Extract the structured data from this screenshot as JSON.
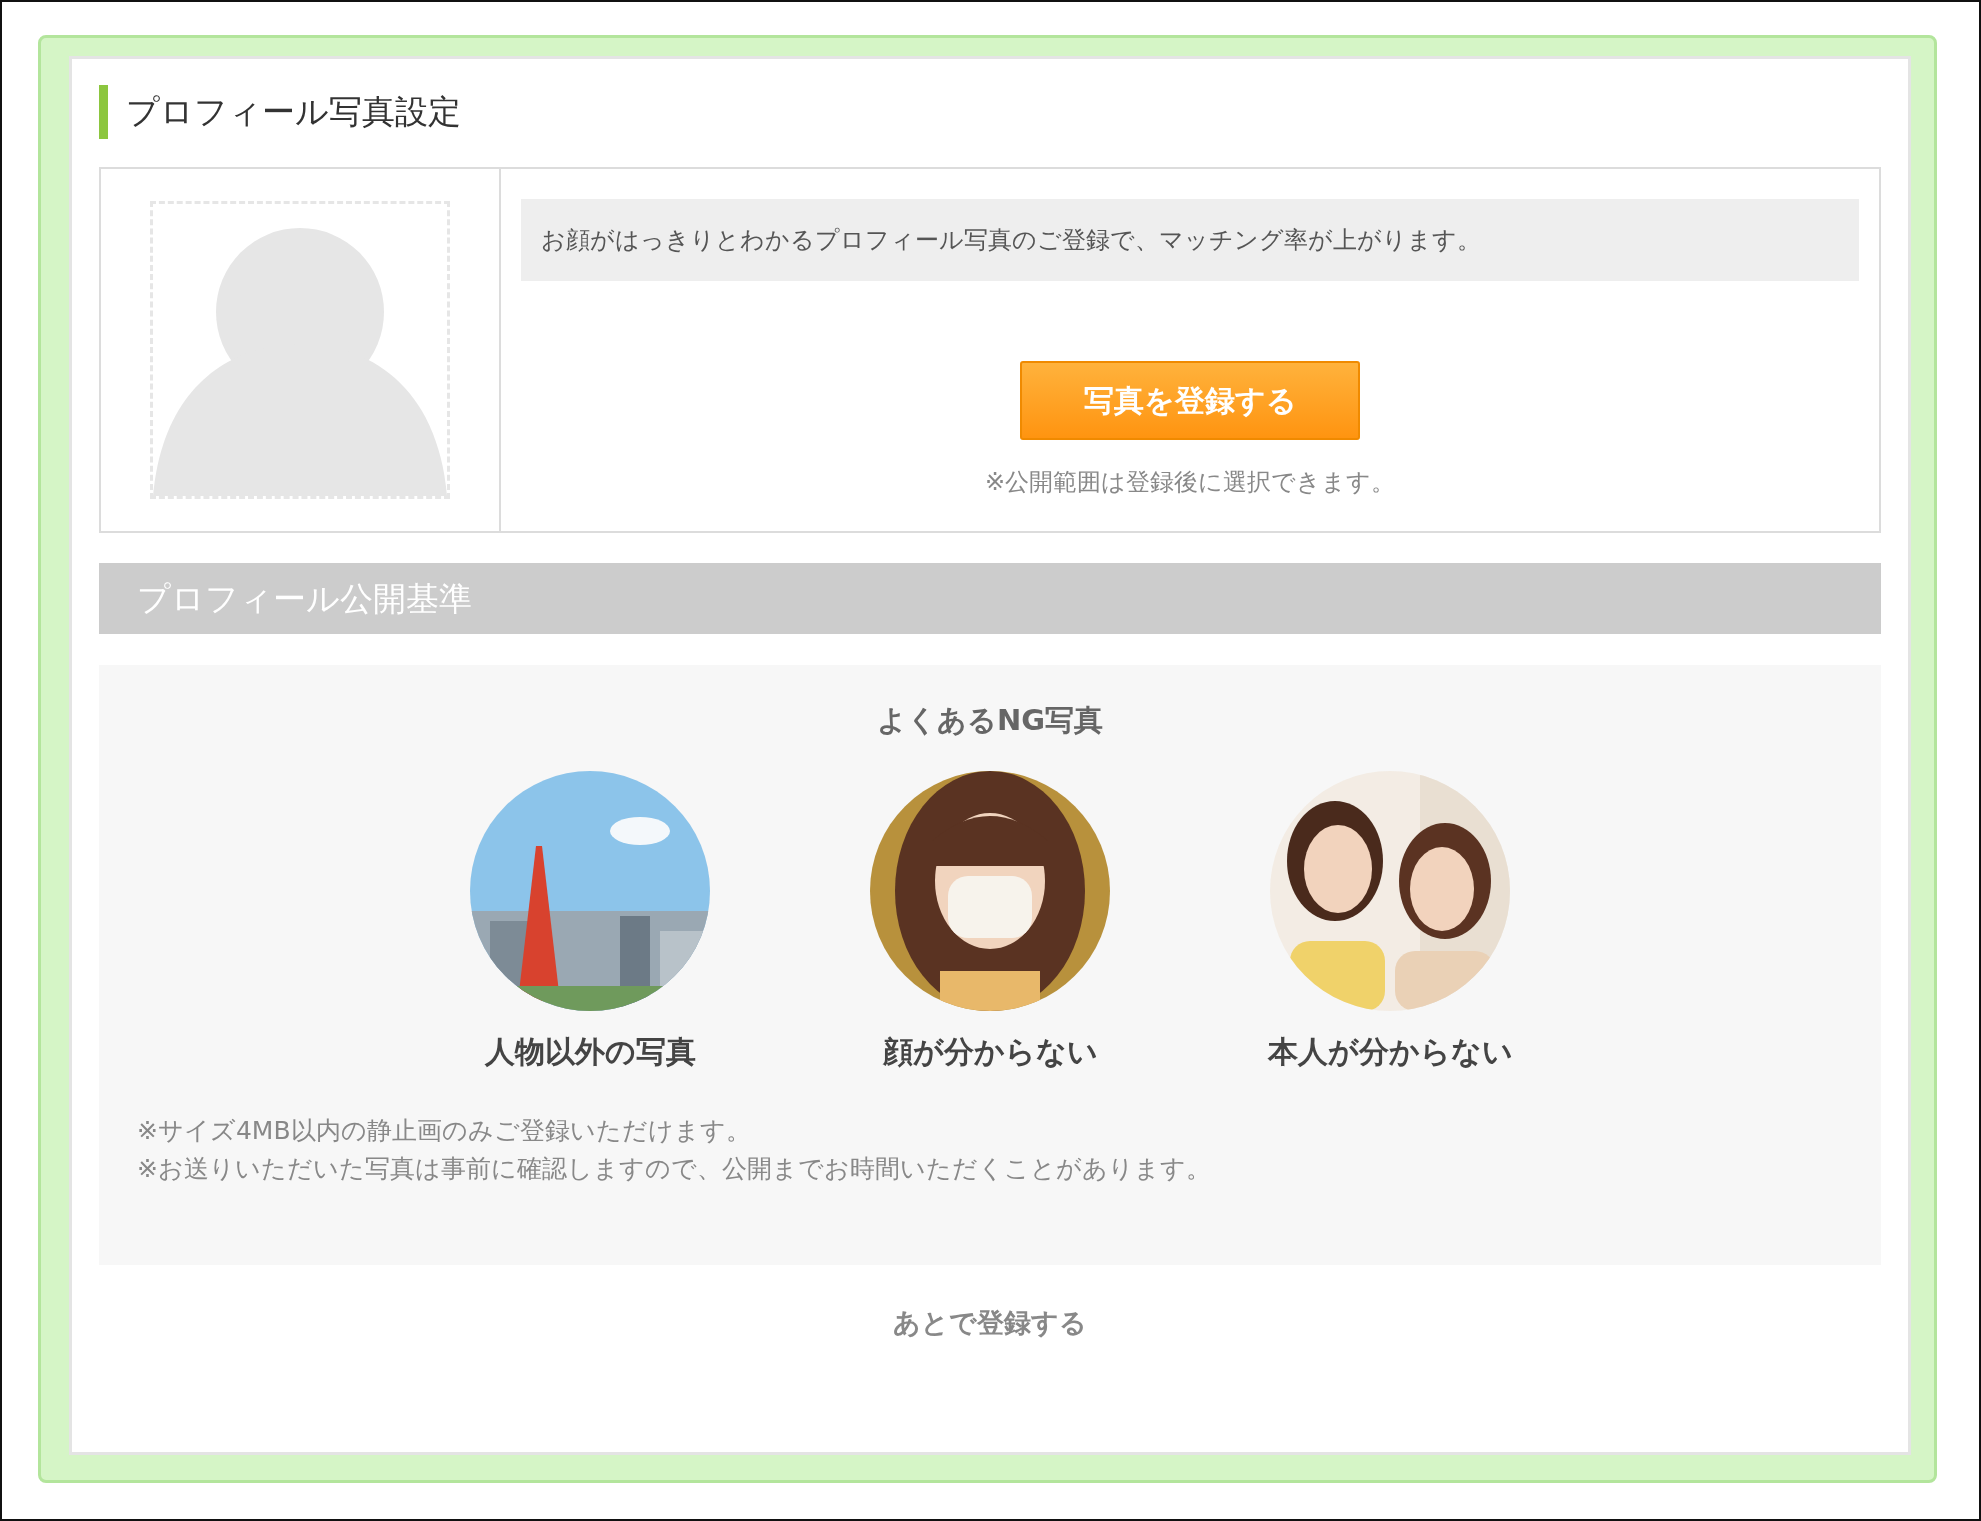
{
  "title": "プロフィール写真設定",
  "photo_section": {
    "hint": "お顔がはっきりとわかるプロフィール写真のご登録で、マッチング率が上がります。",
    "register_button": "写真を登録する",
    "visibility_note": "※公開範囲は登録後に選択できます。"
  },
  "criteria": {
    "heading": "プロフィール公開基準",
    "ng_title": "よくあるNG写真",
    "examples": [
      {
        "kind": "picture",
        "caption": "人物以外の写真"
      },
      {
        "kind": "picture",
        "caption": "顔が分からない"
      },
      {
        "kind": "picture",
        "caption": "本人が分からない"
      }
    ],
    "notes": [
      "※サイズ4MB以内の静止画のみご登録いただけます。",
      "※お送りいただいた写真は事前に確認しますので、公開までお時間いただくことがあります。"
    ]
  },
  "later_link": "あとで登録する"
}
